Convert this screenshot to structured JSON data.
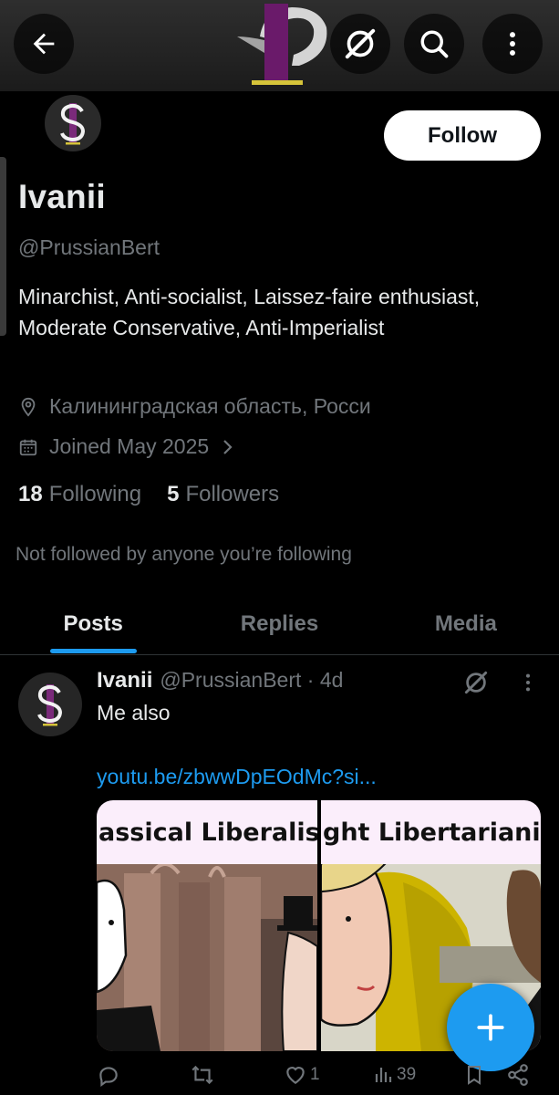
{
  "header": {
    "back_icon": "back-arrow-icon",
    "grok_icon": "grok-icon",
    "search_icon": "search-icon",
    "more_icon": "more-vertical-icon"
  },
  "profile": {
    "follow_label": "Follow",
    "display_name": "Ivanii",
    "handle": "@PrussianBert",
    "bio": "Minarchist, Anti-socialist, Laissez-faire enthusiast, Moderate Conservative, Anti-Imperialist",
    "location": "Калининградская область, Росси",
    "joined": "Joined May 2025",
    "following_count": "18",
    "following_label": "Following",
    "followers_count": "5",
    "followers_label": "Followers",
    "not_followed_note": "Not followed by anyone you’re following"
  },
  "tabs": [
    {
      "label": "Posts",
      "active": true
    },
    {
      "label": "Replies",
      "active": false
    },
    {
      "label": "Media",
      "active": false
    }
  ],
  "post": {
    "author": "Ivanii",
    "handle_time": "@PrussianBert · 4d",
    "text": "Me also",
    "link": "youtu.be/zbwwDpEOdMc?si...",
    "thumb_left_title": "assical Liberalis",
    "thumb_right_title": "ght Libertarianis",
    "replies": "",
    "reposts": "",
    "likes": "1",
    "views": "39"
  },
  "colors": {
    "accent": "#1d9bf0",
    "text_primary": "#e7e9ea",
    "text_secondary": "#71767b",
    "background": "#000000"
  }
}
